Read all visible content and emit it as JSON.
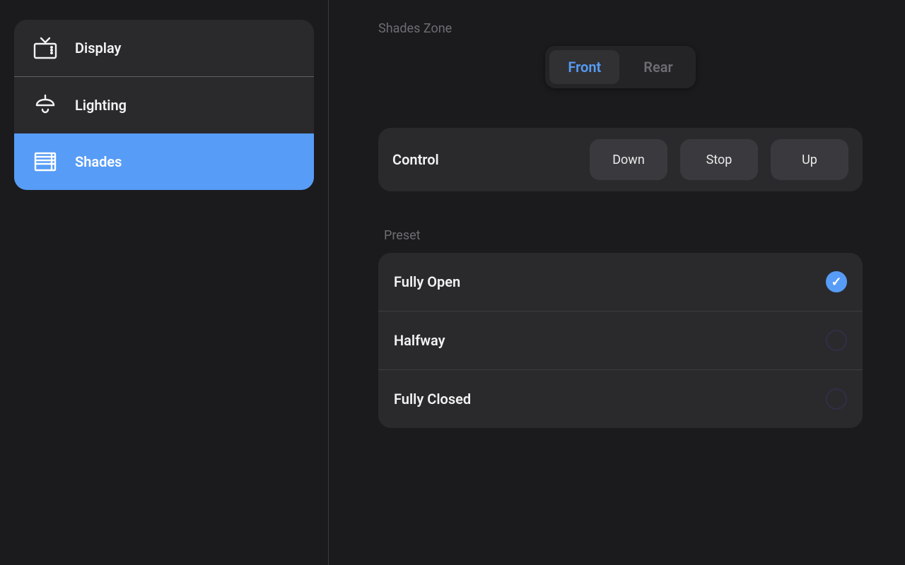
{
  "sidebar": {
    "items": [
      {
        "label": "Display",
        "active": false
      },
      {
        "label": "Lighting",
        "active": false
      },
      {
        "label": "Shades",
        "active": true
      }
    ]
  },
  "main": {
    "zone_label": "Shades Zone",
    "zones": [
      {
        "label": "Front",
        "active": true
      },
      {
        "label": "Rear",
        "active": false
      }
    ],
    "control": {
      "title": "Control",
      "buttons": [
        {
          "label": "Down"
        },
        {
          "label": "Stop"
        },
        {
          "label": "Up"
        }
      ]
    },
    "preset_label": "Preset",
    "presets": [
      {
        "label": "Fully Open",
        "selected": true
      },
      {
        "label": "Halfway",
        "selected": false
      },
      {
        "label": "Fully Closed",
        "selected": false
      }
    ]
  }
}
